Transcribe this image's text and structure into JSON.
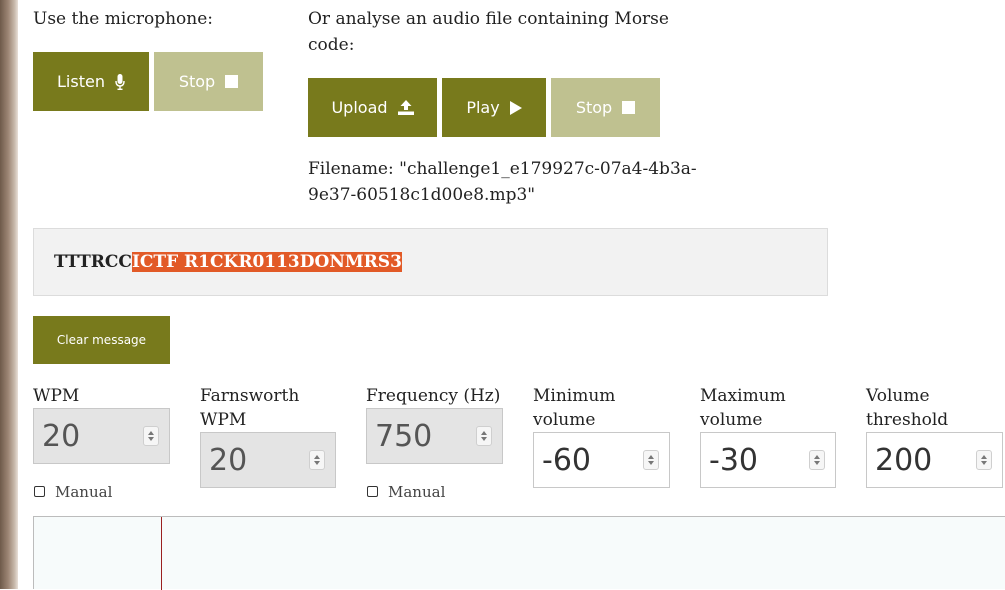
{
  "microphone": {
    "prompt": "Use the microphone:",
    "listen_label": "Listen",
    "listen_icon": "microphone-icon",
    "stop_label": "Stop",
    "stop_icon": "stop-square-icon"
  },
  "file": {
    "prompt_line1": "Or analyse an audio file containing Morse",
    "prompt_line2": "code:",
    "upload_label": "Upload",
    "upload_icon": "upload-icon",
    "play_label": "Play",
    "play_icon": "play-icon",
    "stop_label": "Stop",
    "stop_icon": "stop-square-icon",
    "filename_line1": "Filename: \"challenge1_e179927c-07a4-4b3a-",
    "filename_line2": "9e37-60518c1d00e8.mp3\""
  },
  "message": {
    "plain": "TTTRCC",
    "highlighted": "ICTF R1CKR0113DONMRS3",
    "highlight_color": "#e25a27"
  },
  "clear_label": "Clear message",
  "controls": {
    "wpm": {
      "label": "WPM",
      "value": "20",
      "manual_label": "Manual",
      "manual_checked": false
    },
    "farnsworth": {
      "label_line1": "Farnsworth",
      "label_line2": "WPM",
      "value": "20"
    },
    "frequency": {
      "label": "Frequency (Hz)",
      "value": "750",
      "manual_label": "Manual",
      "manual_checked": false
    },
    "min_volume": {
      "label_line1": "Minimum",
      "label_line2": "volume",
      "value": "-60"
    },
    "max_volume": {
      "label_line1": "Maximum",
      "label_line2": "volume",
      "value": "-30"
    },
    "threshold": {
      "label_line1": "Volume",
      "label_line2": "threshold",
      "value": "200"
    }
  },
  "colors": {
    "accent": "#787a1c",
    "accent_disabled": "#bfc190",
    "background": "#ffffff"
  }
}
